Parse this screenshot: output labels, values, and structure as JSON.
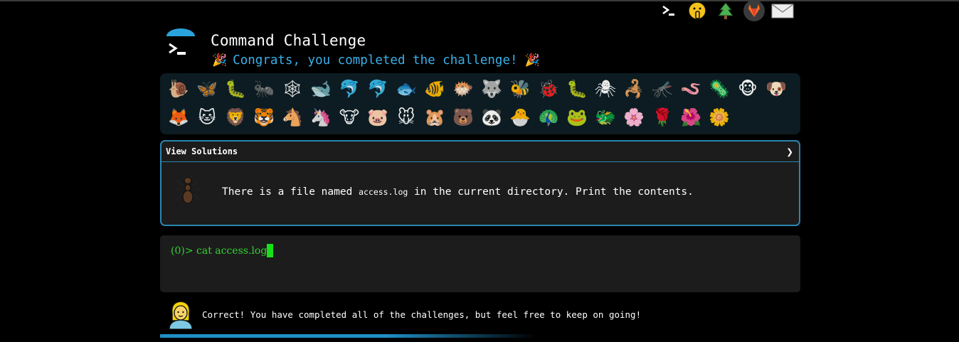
{
  "header": {
    "title": "Command Challenge",
    "congrats": "Congrats, you completed the challenge!",
    "party_emoji": "🎉"
  },
  "top_icons": [
    {
      "name": "terminal-icon"
    },
    {
      "name": "shushing-face-icon",
      "glyph": "🤫"
    },
    {
      "name": "christmas-tree-icon",
      "glyph": "🌲"
    },
    {
      "name": "gitlab-icon"
    },
    {
      "name": "mail-icon"
    }
  ],
  "emojis": [
    "🐌",
    "🦋",
    "🐛",
    "🐜",
    "🕸",
    "🐋",
    "🐬",
    "🐬",
    "🐟",
    "🐠",
    "🐡",
    "🐺",
    "🐝",
    "🐞",
    "🐛",
    "🕷",
    "🦂",
    "🦟",
    "🪱",
    "🦠",
    "🐵",
    "🐶",
    "🦊",
    "🐱",
    "🦁",
    "🐯",
    "🐴",
    "🦄",
    "🐮",
    "🐷",
    "🐭",
    "🐹",
    "🐻",
    "🐼",
    "🐣",
    "🦚",
    "🐸",
    "🐲",
    "🌸",
    "🌹",
    "🌺",
    "🌼"
  ],
  "solutions": {
    "header": "View Solutions",
    "chevron": "❯",
    "task_before": "There is a file named ",
    "task_file": "access.log",
    "task_after": " in the current directory. Print the contents."
  },
  "terminal": {
    "prompt": "(0)> ",
    "command": "cat access.log"
  },
  "status": {
    "message": "Correct! You have completed all of the challenges, but feel free to keep on going!"
  },
  "colors": {
    "accent": "#3bb0e8",
    "border": "#2a86b0",
    "terminal_green": "#33d333",
    "panel_bg": "#0c1c22"
  }
}
